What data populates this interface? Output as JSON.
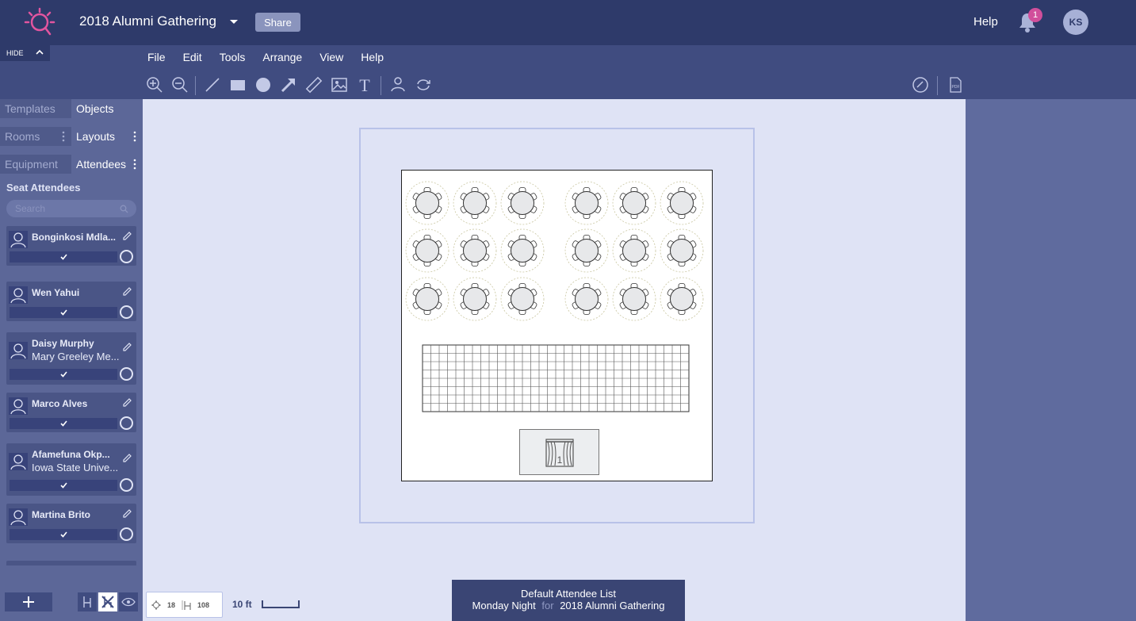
{
  "header": {
    "title": "2018 Alumni Gathering",
    "share_label": "Share",
    "help_label": "Help",
    "notification_count": "1",
    "avatar_initials": "KS"
  },
  "toolbar": {
    "hide_label": "HIDE",
    "menu": [
      "File",
      "Edit",
      "Tools",
      "Arrange",
      "View",
      "Help"
    ],
    "tools": [
      "zoom-in-icon",
      "zoom-out-icon",
      "line-icon",
      "rectangle-icon",
      "circle-icon",
      "arrow-icon",
      "ruler-icon",
      "image-icon",
      "text-icon",
      "seat-person-icon",
      "rotate-icon",
      "link-icon",
      "pdf-icon"
    ]
  },
  "sidebar": {
    "tabs_row1": [
      "Templates",
      "Objects"
    ],
    "tabs_row2": [
      "Rooms",
      "Layouts"
    ],
    "tabs_row3": [
      "Equipment",
      "Attendees"
    ],
    "section_title": "Seat Attendees",
    "search_placeholder": "Search",
    "attendees": [
      {
        "name": "Bonginkosi Mdla...",
        "org": ""
      },
      {
        "name": "Wen Yahui",
        "org": ""
      },
      {
        "name": "Daisy Murphy",
        "org": "Mary Greeley Me..."
      },
      {
        "name": "Marco Alves",
        "org": ""
      },
      {
        "name": "Afamefuna Okp...",
        "org": "Iowa State Unive..."
      },
      {
        "name": "Martina Brito",
        "org": ""
      }
    ]
  },
  "canvas": {
    "table_count": "18",
    "seat_count": "108",
    "scale_label": "10 ft",
    "round_tables": 18,
    "chairs_per_table": 6
  },
  "list_info": {
    "list_name": "Default Attendee List",
    "night": "Monday Night",
    "for_word": "for",
    "event": "2018 Alumni Gathering"
  },
  "colors": {
    "header_bg": "#2e3a6a",
    "toolbar_bg": "#404c80",
    "sidebar_bg": "#5c6798",
    "canvas_bg": "#dfe3f5",
    "accent_pink": "#d14f9b"
  }
}
